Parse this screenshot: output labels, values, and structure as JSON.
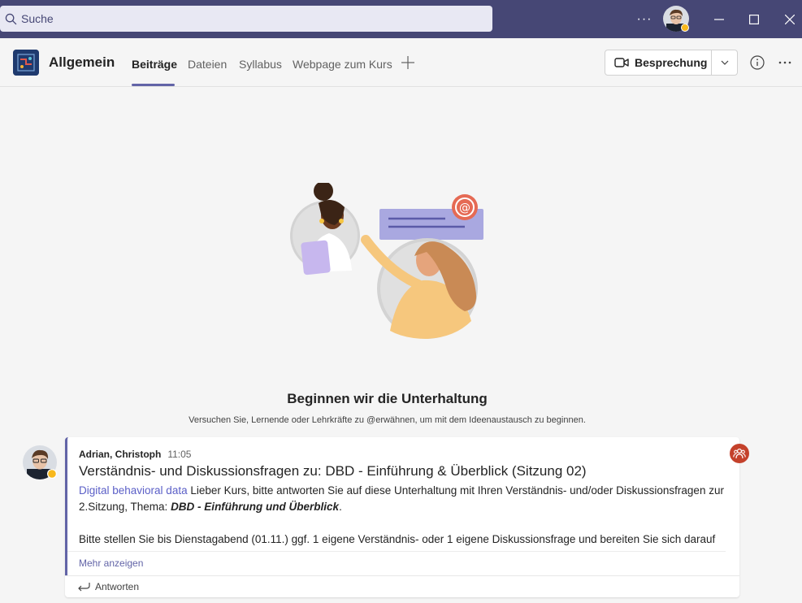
{
  "search": {
    "placeholder": "Suche"
  },
  "titlebar": {
    "more_label": "···"
  },
  "channel": {
    "name": "Allgemein"
  },
  "tabs": [
    {
      "label": "Beiträge",
      "active": true
    },
    {
      "label": "Dateien"
    },
    {
      "label": "Syllabus"
    },
    {
      "label": "Webpage zum Kurs"
    }
  ],
  "header": {
    "meeting_label": "Besprechung"
  },
  "empty_state": {
    "title": "Beginnen wir die Unterhaltung",
    "subtitle": "Versuchen Sie, Lernende oder Lehrkräfte zu @erwähnen, um mit dem Ideenaustausch zu beginnen."
  },
  "post": {
    "author": "Adrian, Christoph",
    "time": "11:05",
    "title": "Verständnis- und Diskussionsfragen zu: DBD - Einführung & Überblick (Sitzung 02)",
    "mention": "Digital behavioral data",
    "body_1": " Lieber Kurs, bitte antworten Sie auf diese Unterhaltung mit Ihren Verständnis- und/oder Diskussionsfragen zur 2.Sitzung, Thema: ",
    "body_bold": "DBD - Einführung und Überblick",
    "body_1_end": ".",
    "body_2": "Bitte stellen Sie bis Dienstagabend (01.11.) ggf. 1 eigene Verständnis- oder 1 eigene Diskussionsfrage und bereiten Sie sich darauf vor, Ihre Fragen in der Sitzung stellen und begründen zu können.",
    "more_label": "Mehr anzeigen",
    "reply_label": "Antworten"
  },
  "colors": {
    "titlebar": "#464775",
    "accent": "#6264a7",
    "reaction": "#c4412b"
  }
}
